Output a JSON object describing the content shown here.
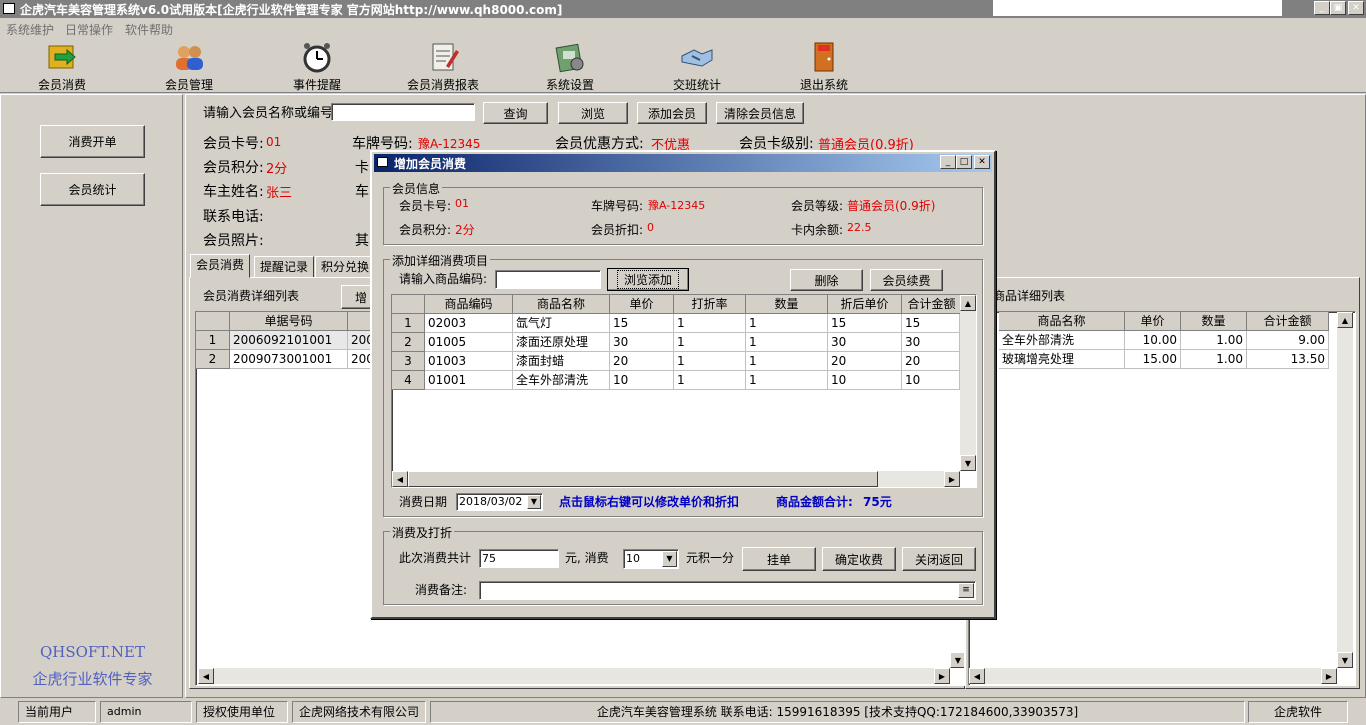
{
  "window": {
    "title": "企虎汽车美容管理系统v6.0试用版本[企虎行业软件管理专家 官方网站http://www.qh8000.com]"
  },
  "menu": [
    "系统维护",
    "日常操作",
    "软件帮助"
  ],
  "toolbar": [
    {
      "label": "会员消费",
      "icon": "money-icon"
    },
    {
      "label": "会员管理",
      "icon": "users-icon"
    },
    {
      "label": "事件提醒",
      "icon": "alarm-clock-icon"
    },
    {
      "label": "会员消费报表",
      "icon": "report-icon"
    },
    {
      "label": "系统设置",
      "icon": "settings-icon"
    },
    {
      "label": "交班统计",
      "icon": "handshake-icon"
    },
    {
      "label": "退出系统",
      "icon": "exit-door-icon"
    }
  ],
  "left_panel": {
    "open_bill": "消费开单",
    "stats": "会员统计",
    "brand1": "QHSOFT.NET",
    "brand2": "企虎行业软件专家"
  },
  "search": {
    "label": "请输入会员名称或编号",
    "value": "",
    "query": "查询",
    "browse": "浏览",
    "add_member": "添加会员",
    "clear": "清除会员信息"
  },
  "member_info": {
    "card_no_label": "会员卡号:",
    "card_no": "01",
    "plate_label": "车牌号码:",
    "plate": "豫A-12345",
    "discount_label": "会员优惠方式:",
    "discount": "不优惠",
    "level_label": "会员卡级别:",
    "level": "普通会员(0.9折)",
    "points_label": "会员积分:",
    "points": "2分",
    "card_stub": "卡",
    "owner_label": "车主姓名:",
    "owner": "张三",
    "car_stub": "车",
    "phone_label": "联系电话:",
    "photo_label": "会员照片:",
    "other_stub": "其"
  },
  "tabs": [
    "会员消费",
    "提醒记录",
    "积分兑换"
  ],
  "consume_list": {
    "title": "会员消费详细列表",
    "add_stub": "增",
    "header": "单据号码",
    "col2_stub": "",
    "rows": [
      {
        "n": "1",
        "id": "2006092101001",
        "d": "200"
      },
      {
        "n": "2",
        "id": "2009073001001",
        "d": "200"
      }
    ]
  },
  "product_detail": {
    "title": "商品详细列表",
    "headers": [
      "商品名称",
      "单价",
      "数量",
      "合计金额"
    ],
    "rows": [
      [
        "全车外部清洗",
        "10.00",
        "1.00",
        "9.00"
      ],
      [
        "玻璃增亮处理",
        "15.00",
        "1.00",
        "13.50"
      ]
    ]
  },
  "dialog": {
    "title": "增加会员消费",
    "info_group": "会员信息",
    "card_no_label": "会员卡号:",
    "card_no": "01",
    "plate_label": "车牌号码:",
    "plate": "豫A-12345",
    "level_label": "会员等级:",
    "level": "普通会员(0.9折)",
    "points_label": "会员积分:",
    "points": "2分",
    "discount_label": "会员折扣:",
    "discount": "0",
    "balance_label": "卡内余额:",
    "balance": "22.5",
    "items_group": "添加详细消费项目",
    "product_code_label": "请输入商品编码:",
    "product_code": "",
    "browse_add": "浏览添加",
    "delete": "删除",
    "renew": "会员续费",
    "grid_headers": [
      "商品编码",
      "商品名称",
      "单价",
      "打折率",
      "数量",
      "折后单价",
      "合计金额"
    ],
    "grid_rows": [
      [
        "1",
        "02003",
        "氙气灯",
        "15",
        "1",
        "1",
        "15",
        "15"
      ],
      [
        "2",
        "01005",
        "漆面还原处理",
        "30",
        "1",
        "1",
        "30",
        "30"
      ],
      [
        "3",
        "01003",
        "漆面封蜡",
        "20",
        "1",
        "1",
        "20",
        "20"
      ],
      [
        "4",
        "01001",
        "全车外部清洗",
        "10",
        "1",
        "1",
        "10",
        "10"
      ]
    ],
    "date_label": "消费日期",
    "date": "2018/03/02",
    "hint": "点击鼠标右键可以修改单价和折扣",
    "total_label": "商品金额合计:",
    "total": "75元",
    "pay_group": "消费及打折",
    "total_consume_label": "此次消费共计",
    "total_consume": "75",
    "yuan_consume": "元, 消费",
    "per_yuan": "10",
    "point_suffix": "元积一分",
    "hang": "挂单",
    "confirm": "确定收费",
    "close": "关闭返回",
    "remark_label": "消费备注:",
    "remark": ""
  },
  "statusbar": {
    "user_label": "当前用户",
    "user": "admin",
    "licensee_label": "授权使用单位",
    "licensee": "企虎网络技术有限公司",
    "info": "企虎汽车美容管理系统 联系电话: 15991618395 [技术支持QQ:172184600,33903573]",
    "brand": "企虎软件"
  }
}
